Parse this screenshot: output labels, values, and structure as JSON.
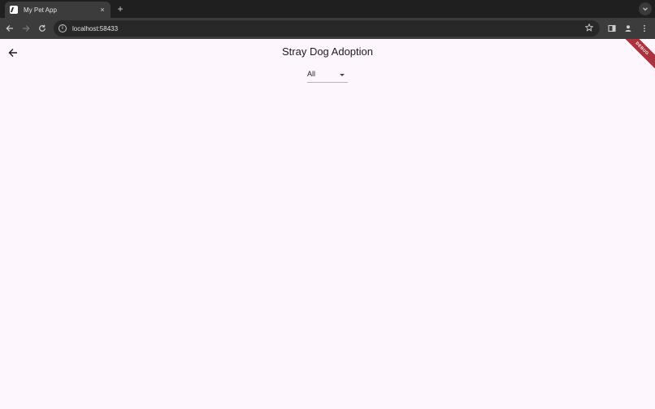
{
  "browser": {
    "tab": {
      "title": "My Pet App",
      "close_label": "×",
      "favicon": "flutter-icon"
    },
    "new_tab_label": "+",
    "url": "localhost:58433"
  },
  "app": {
    "title": "Stray Dog Adoption",
    "filter": {
      "selected": "All"
    },
    "debug_banner": "DEBUG"
  }
}
